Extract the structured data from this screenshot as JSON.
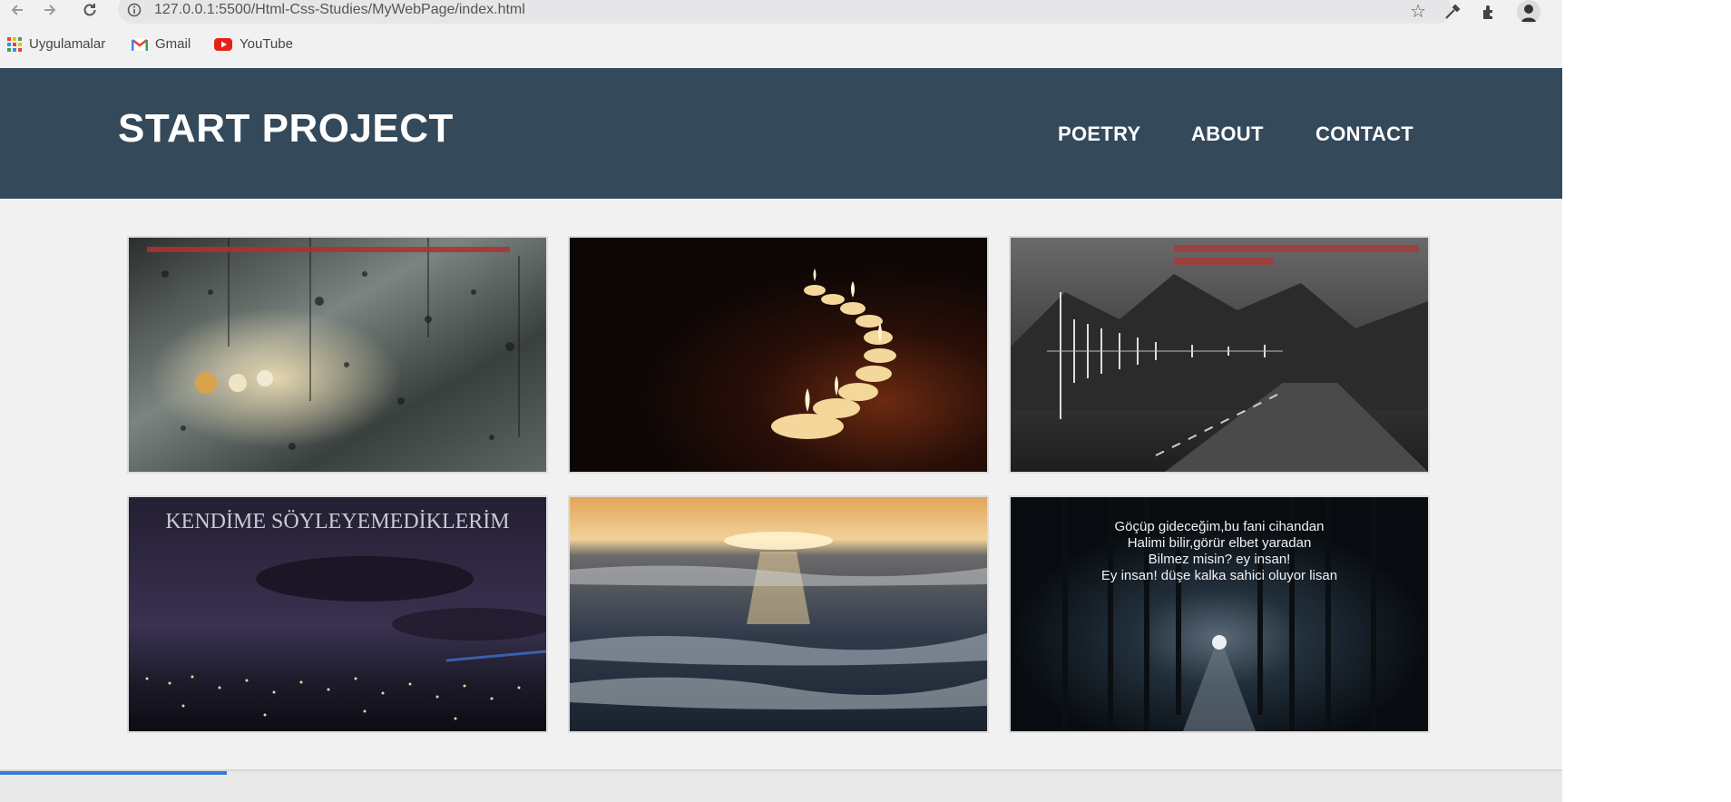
{
  "browser": {
    "url": "127.0.0.1:5500/Html-Css-Studies/MyWebPage/index.html",
    "icons": [
      "back-arrow-icon",
      "forward-arrow-icon",
      "reload-icon",
      "info-icon",
      "star-icon",
      "eyedropper-icon",
      "extensions-icon",
      "profile-avatar-icon"
    ],
    "bookmarks": [
      {
        "label": "Uygulamalar",
        "icon": "apps-grid-icon"
      },
      {
        "label": "Gmail",
        "icon": "gmail-icon"
      },
      {
        "label": "YouTube",
        "icon": "youtube-icon"
      }
    ]
  },
  "site": {
    "brand": "START PROJECT",
    "nav": [
      "POETRY",
      "ABOUT",
      "CONTACT"
    ],
    "header_color": "#34495a",
    "page_bg": "#f1f1f2"
  },
  "gallery": {
    "tiles": [
      {
        "scene": "rain-on-window",
        "caption_lines": []
      },
      {
        "scene": "candles",
        "caption_lines": []
      },
      {
        "scene": "misty-road",
        "caption_lines": []
      },
      {
        "scene": "night-city",
        "caption_lines": [
          "KENDİME SÖYLEYEMEDİKLERİM"
        ]
      },
      {
        "scene": "sea-sunset",
        "caption_lines": []
      },
      {
        "scene": "dark-forest-road",
        "caption_lines": [
          "Göçüp gideceğim,bu fani cihandan",
          "Halimi bilir,görür elbet yaradan",
          "Bilmez misin? ey insan!",
          "Ey insan! düşe kalka sahici oluyor lisan"
        ]
      }
    ]
  }
}
